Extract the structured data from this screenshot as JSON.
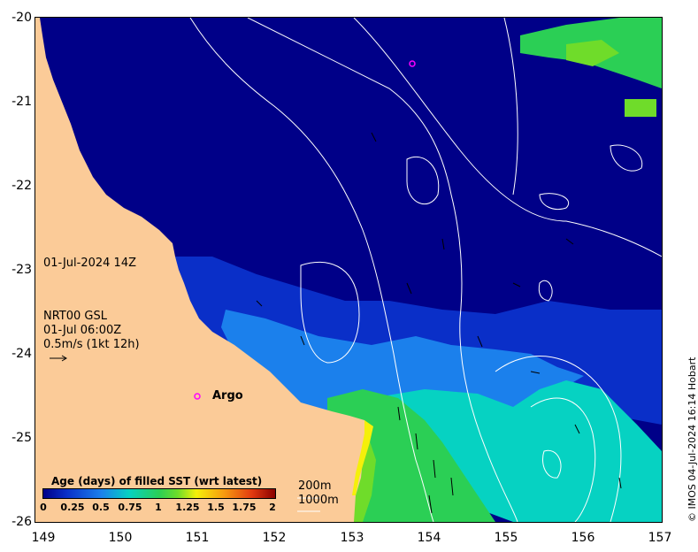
{
  "map": {
    "date_label": "01-Jul-2024 14Z",
    "current_source": "NRT00 GSL",
    "current_date": "01-Jul 06:00Z",
    "current_scale": "0.5m/s (1kt 12h)",
    "argo_label": "Argo",
    "depth_contours": [
      "200m",
      "1000m"
    ],
    "credit": "© IMOS 04-Jul-2024 16:14 Hobart",
    "lon_ticks": [
      "149",
      "150",
      "151",
      "152",
      "153",
      "154",
      "155",
      "156",
      "157"
    ],
    "lat_ticks": [
      "-20",
      "-21",
      "-22",
      "-23",
      "-24",
      "-25",
      "-26"
    ]
  },
  "colorbar": {
    "title": "Age (days) of filled SST (wrt latest)",
    "ticks": [
      "0",
      "0.25",
      "0.5",
      "0.75",
      "1",
      "1.25",
      "1.5",
      "1.75",
      "2"
    ]
  },
  "colors": {
    "land": "#fbcb98",
    "age_0": "#000088",
    "age_0_25": "#0a2fc8",
    "age_0_5": "#1b80ec",
    "age_0_75": "#06d2c2",
    "age_1": "#2bcf55",
    "age_1_25": "#6fdc2a",
    "age_1_5": "#f5f00a",
    "argo_marker": "#ff00ff",
    "contour": "#ffffff"
  }
}
